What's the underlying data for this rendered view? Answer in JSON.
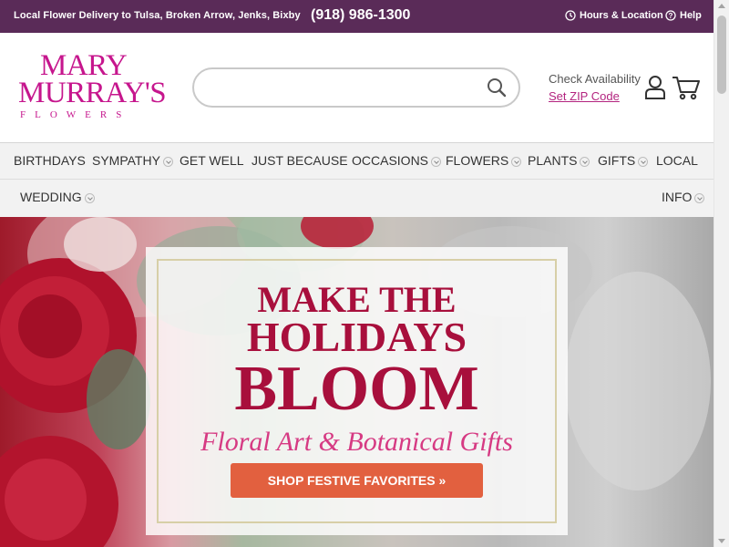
{
  "topbar": {
    "promo": "Local Flower Delivery to Tulsa, Broken Arrow, Jenks, Bixby",
    "phone": "(918) 986-1300",
    "hours_label": "Hours & Location",
    "help_label": "Help"
  },
  "logo": {
    "line1": "MARY",
    "line2": "MURRAY'S",
    "line3": "FLOWERS"
  },
  "search": {
    "placeholder": "",
    "value": ""
  },
  "zip": {
    "check_label": "Check Availability",
    "set_label": "Set ZIP Code"
  },
  "nav": {
    "row1": [
      {
        "label": "BIRTHDAYS",
        "dropdown": false
      },
      {
        "label": "SYMPATHY",
        "dropdown": true
      },
      {
        "label": "GET WELL",
        "dropdown": false
      },
      {
        "label": "JUST BECAUSE",
        "dropdown": false
      },
      {
        "label": "OCCASIONS",
        "dropdown": true
      },
      {
        "label": "FLOWERS",
        "dropdown": true
      },
      {
        "label": "PLANTS",
        "dropdown": true
      },
      {
        "label": "GIFTS",
        "dropdown": true
      },
      {
        "label": "LOCAL",
        "dropdown": false
      }
    ],
    "row2": [
      {
        "label": "WEDDING",
        "dropdown": true
      },
      {
        "label": "INFO",
        "dropdown": true
      }
    ]
  },
  "hero": {
    "line1": "MAKE THE",
    "line2": "HOLIDAYS",
    "line3": "BLOOM",
    "subtitle": "Floral Art & Botanical Gifts",
    "cta": "SHOP FESTIVE FAVORITES »"
  },
  "colors": {
    "topbar": "#5a2b58",
    "brand_pink": "#c6168d",
    "headline": "#a80f3c",
    "subtitle": "#d63a83",
    "cta": "#e2603f"
  }
}
